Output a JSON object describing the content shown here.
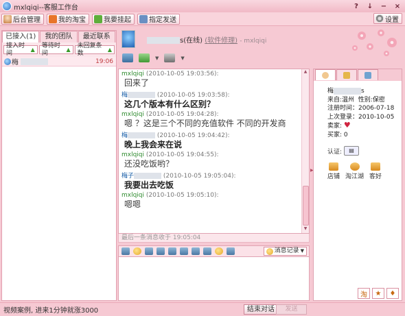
{
  "window": {
    "title": "mxlqiqi--客服工作台",
    "controls": [
      "?",
      "↓",
      "−",
      "×"
    ]
  },
  "toolbar": {
    "buttons": [
      "后台管理",
      "我的淘宝",
      "我要挂起",
      "指定发送"
    ],
    "settings_label": "设置"
  },
  "left_panel": {
    "tabs": [
      "已接入(1)",
      "我的团队",
      "最近联系"
    ],
    "sort_buttons": [
      "接入时间",
      "等待时间",
      "未回复条数"
    ],
    "contacts": [
      {
        "name": "梅",
        "time": "19:06"
      }
    ]
  },
  "chat_header": {
    "name_suffix": "s(在线)",
    "link": "(软件修理)",
    "agent": "- mxlqiqi"
  },
  "messages": [
    {
      "sender": "mxlqiqi",
      "self": true,
      "time": "(2010-10-05 19:03:56):",
      "text": "回来了",
      "bold": false
    },
    {
      "sender": "梅",
      "self": false,
      "time": "(2010-10-05 19:03:58):",
      "text": "这几个版本有什么区别？",
      "bold": true
    },
    {
      "sender": "mxlqiqi",
      "self": true,
      "time": "(2010-10-05 19:04:28):",
      "text": "嗯 ？这是三个不同的充值软件 不同的开发商",
      "bold": false
    },
    {
      "sender": "梅",
      "self": false,
      "time": "(2010-10-05 19:04:42):",
      "text": "晚上我会来在说",
      "bold": true
    },
    {
      "sender": "mxlqiqi",
      "self": true,
      "time": "(2010-10-05 19:04:55):",
      "text": "还没吃饭哟？",
      "bold": false
    },
    {
      "sender": "梅子",
      "self": false,
      "time": "(2010-10-05 19:05:04):",
      "text": "我要出去吃饭",
      "bold": true
    },
    {
      "sender": "mxlqiqi",
      "self": true,
      "time": "(2010-10-05 19:05:10):",
      "text": "嗯嗯",
      "bold": false
    }
  ],
  "last_message": "最后一条消息收于 19:05:04",
  "input": {
    "history_label": "消息记录"
  },
  "customer_info": {
    "name_prefix": "梅",
    "name_suffix": "s",
    "from": "来自:温州",
    "gender": "性别:保密",
    "register": "注册时间：2006-07-18",
    "last_login": "上次登录：2010-10-05",
    "seller": "卖家:",
    "buyer": "买家: 0",
    "auth": "认证:",
    "tools": [
      "店铺",
      "淘江湖",
      "客好"
    ]
  },
  "status": {
    "text": "视频案例, 进来1分钟就涨3000",
    "end_button": "结束对话",
    "send_button": "发送"
  }
}
